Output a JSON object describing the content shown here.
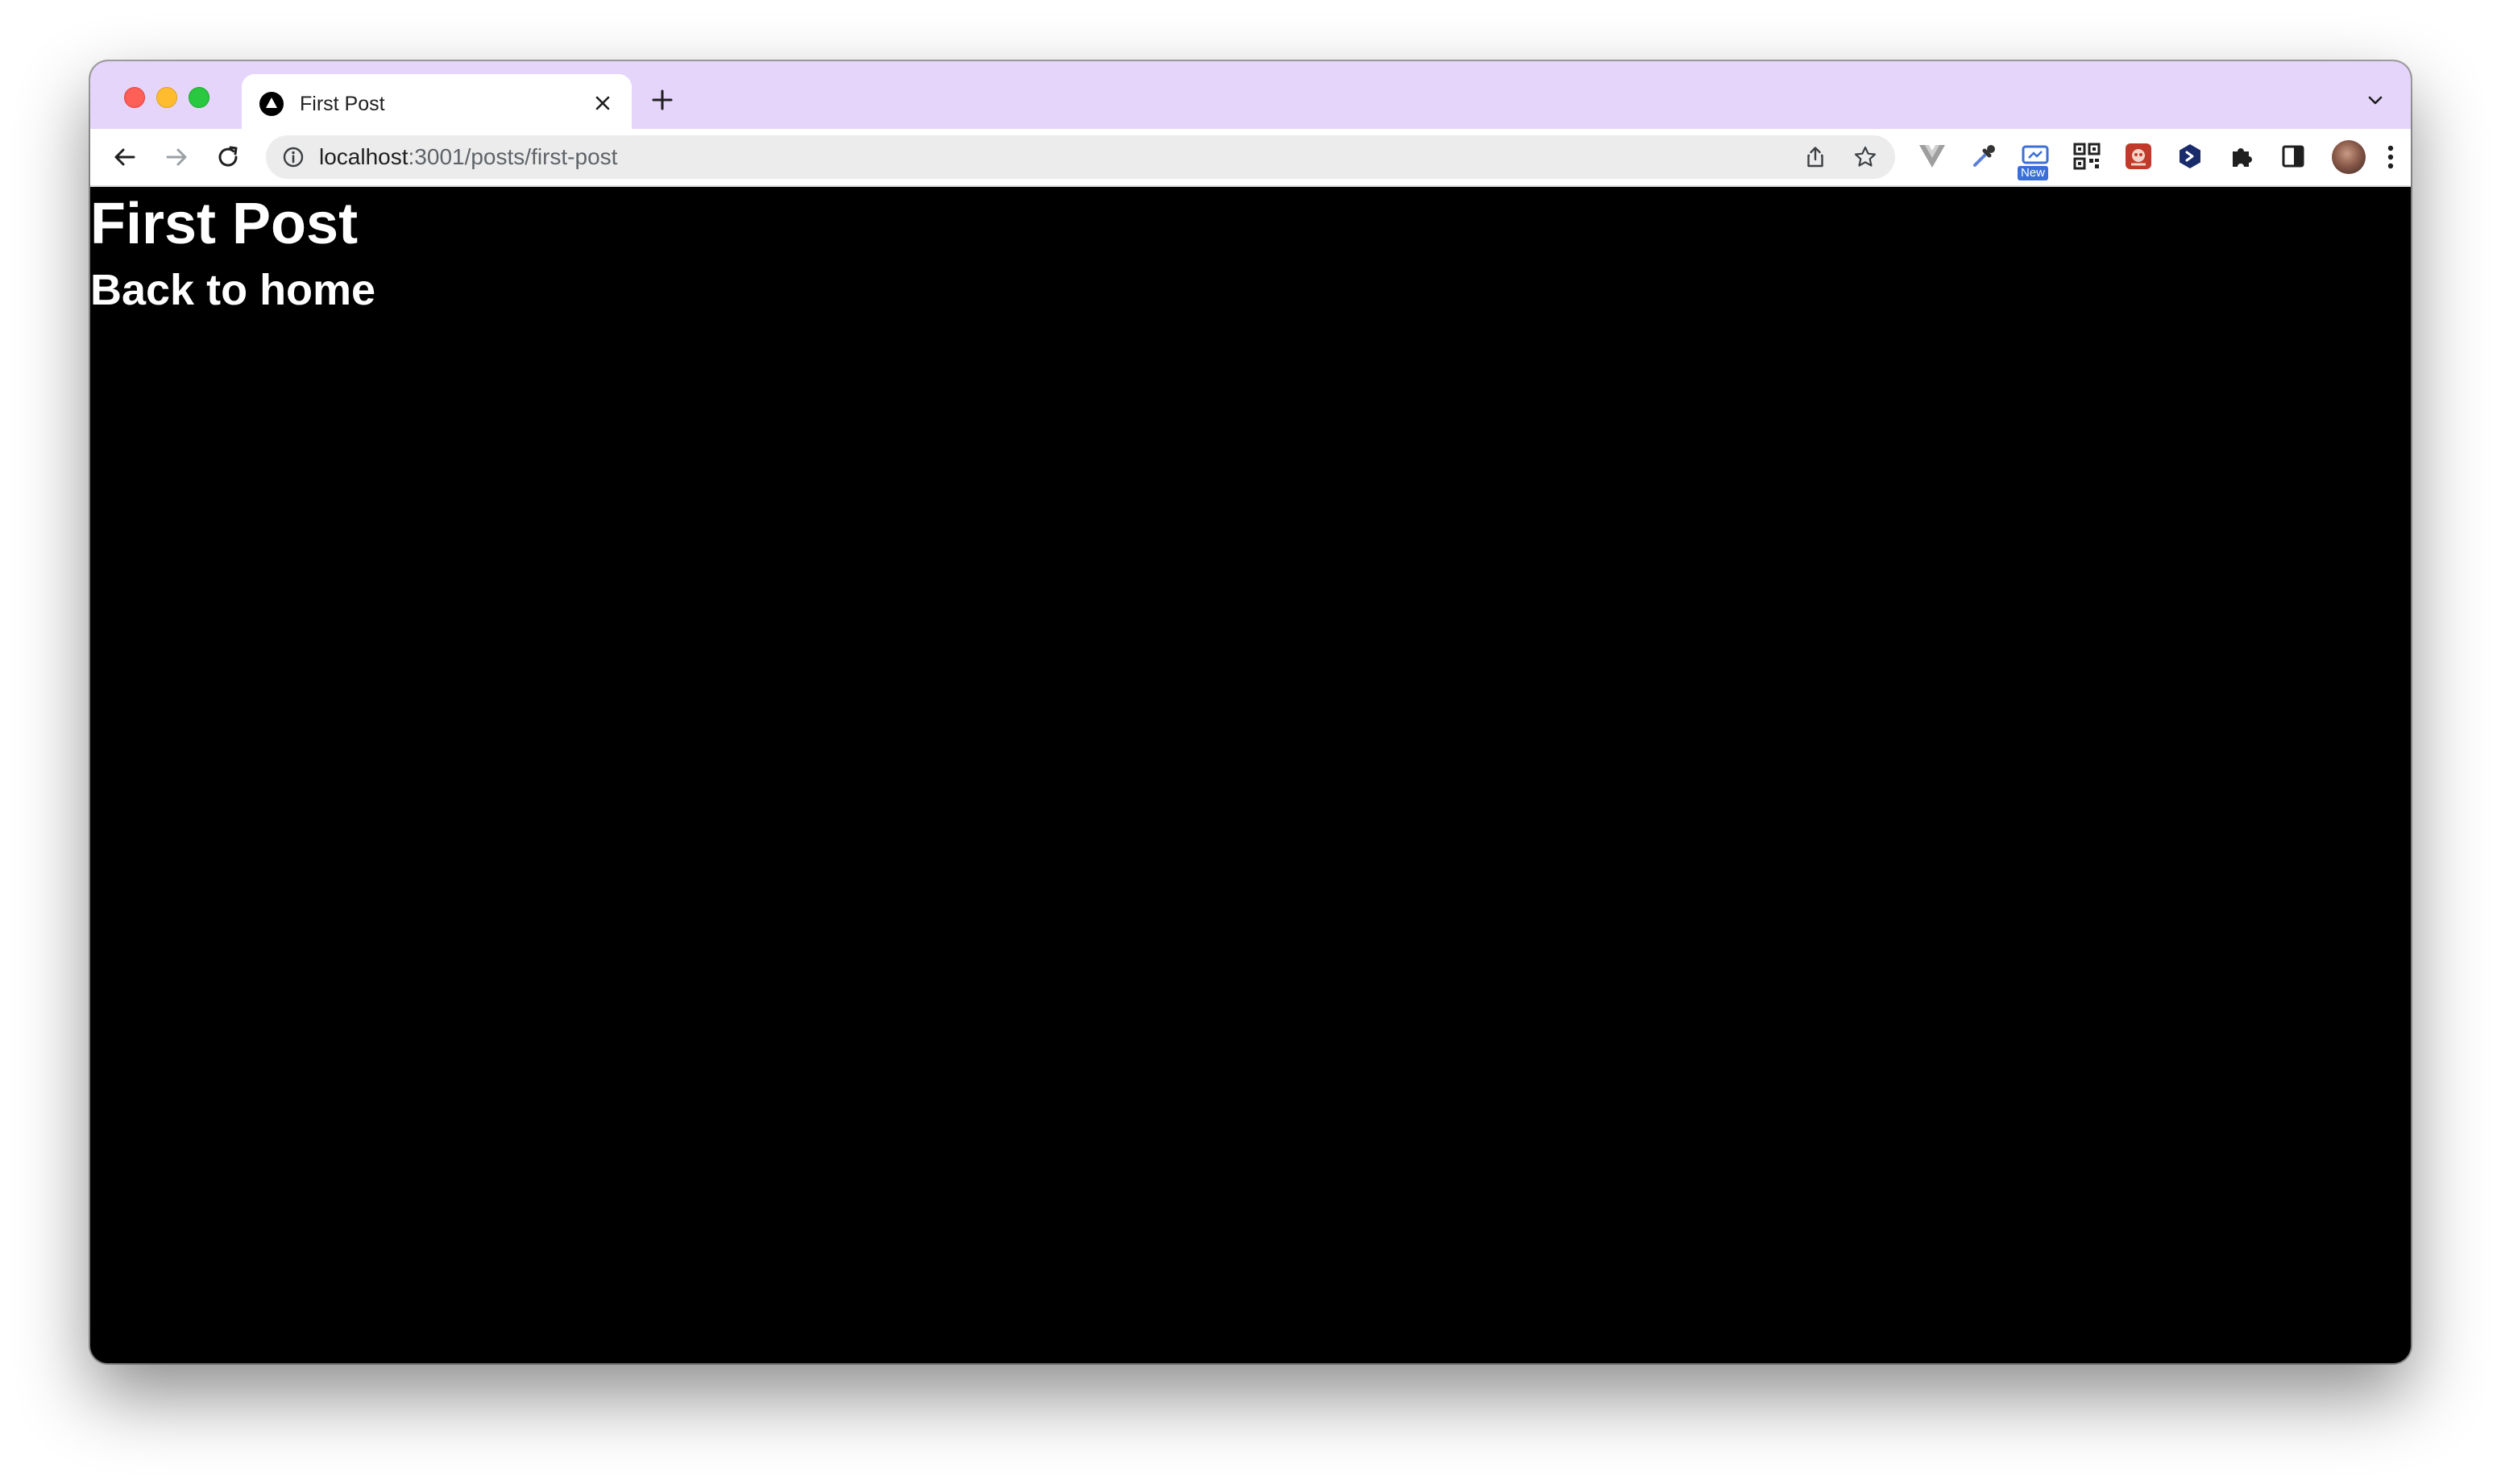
{
  "browser": {
    "tab": {
      "title": "First Post",
      "favicon": "triangle-logo-icon"
    },
    "address_bar": {
      "host": "localhost",
      "path": ":3001/posts/first-post"
    },
    "extensions": [
      {
        "name": "vue-devtools-icon"
      },
      {
        "name": "color-picker-icon"
      },
      {
        "name": "screenshot-extension-icon",
        "badge": "New"
      },
      {
        "name": "qr-code-icon"
      },
      {
        "name": "red-extension-icon"
      },
      {
        "name": "hexagon-extension-icon"
      },
      {
        "name": "puzzle-icon"
      },
      {
        "name": "side-panel-icon"
      }
    ],
    "colors": {
      "tabstrip": "#e6d5fb",
      "page_background": "#000000",
      "page_text": "#ffffff"
    }
  },
  "page": {
    "title": "First Post",
    "back_link": "Back to home"
  }
}
